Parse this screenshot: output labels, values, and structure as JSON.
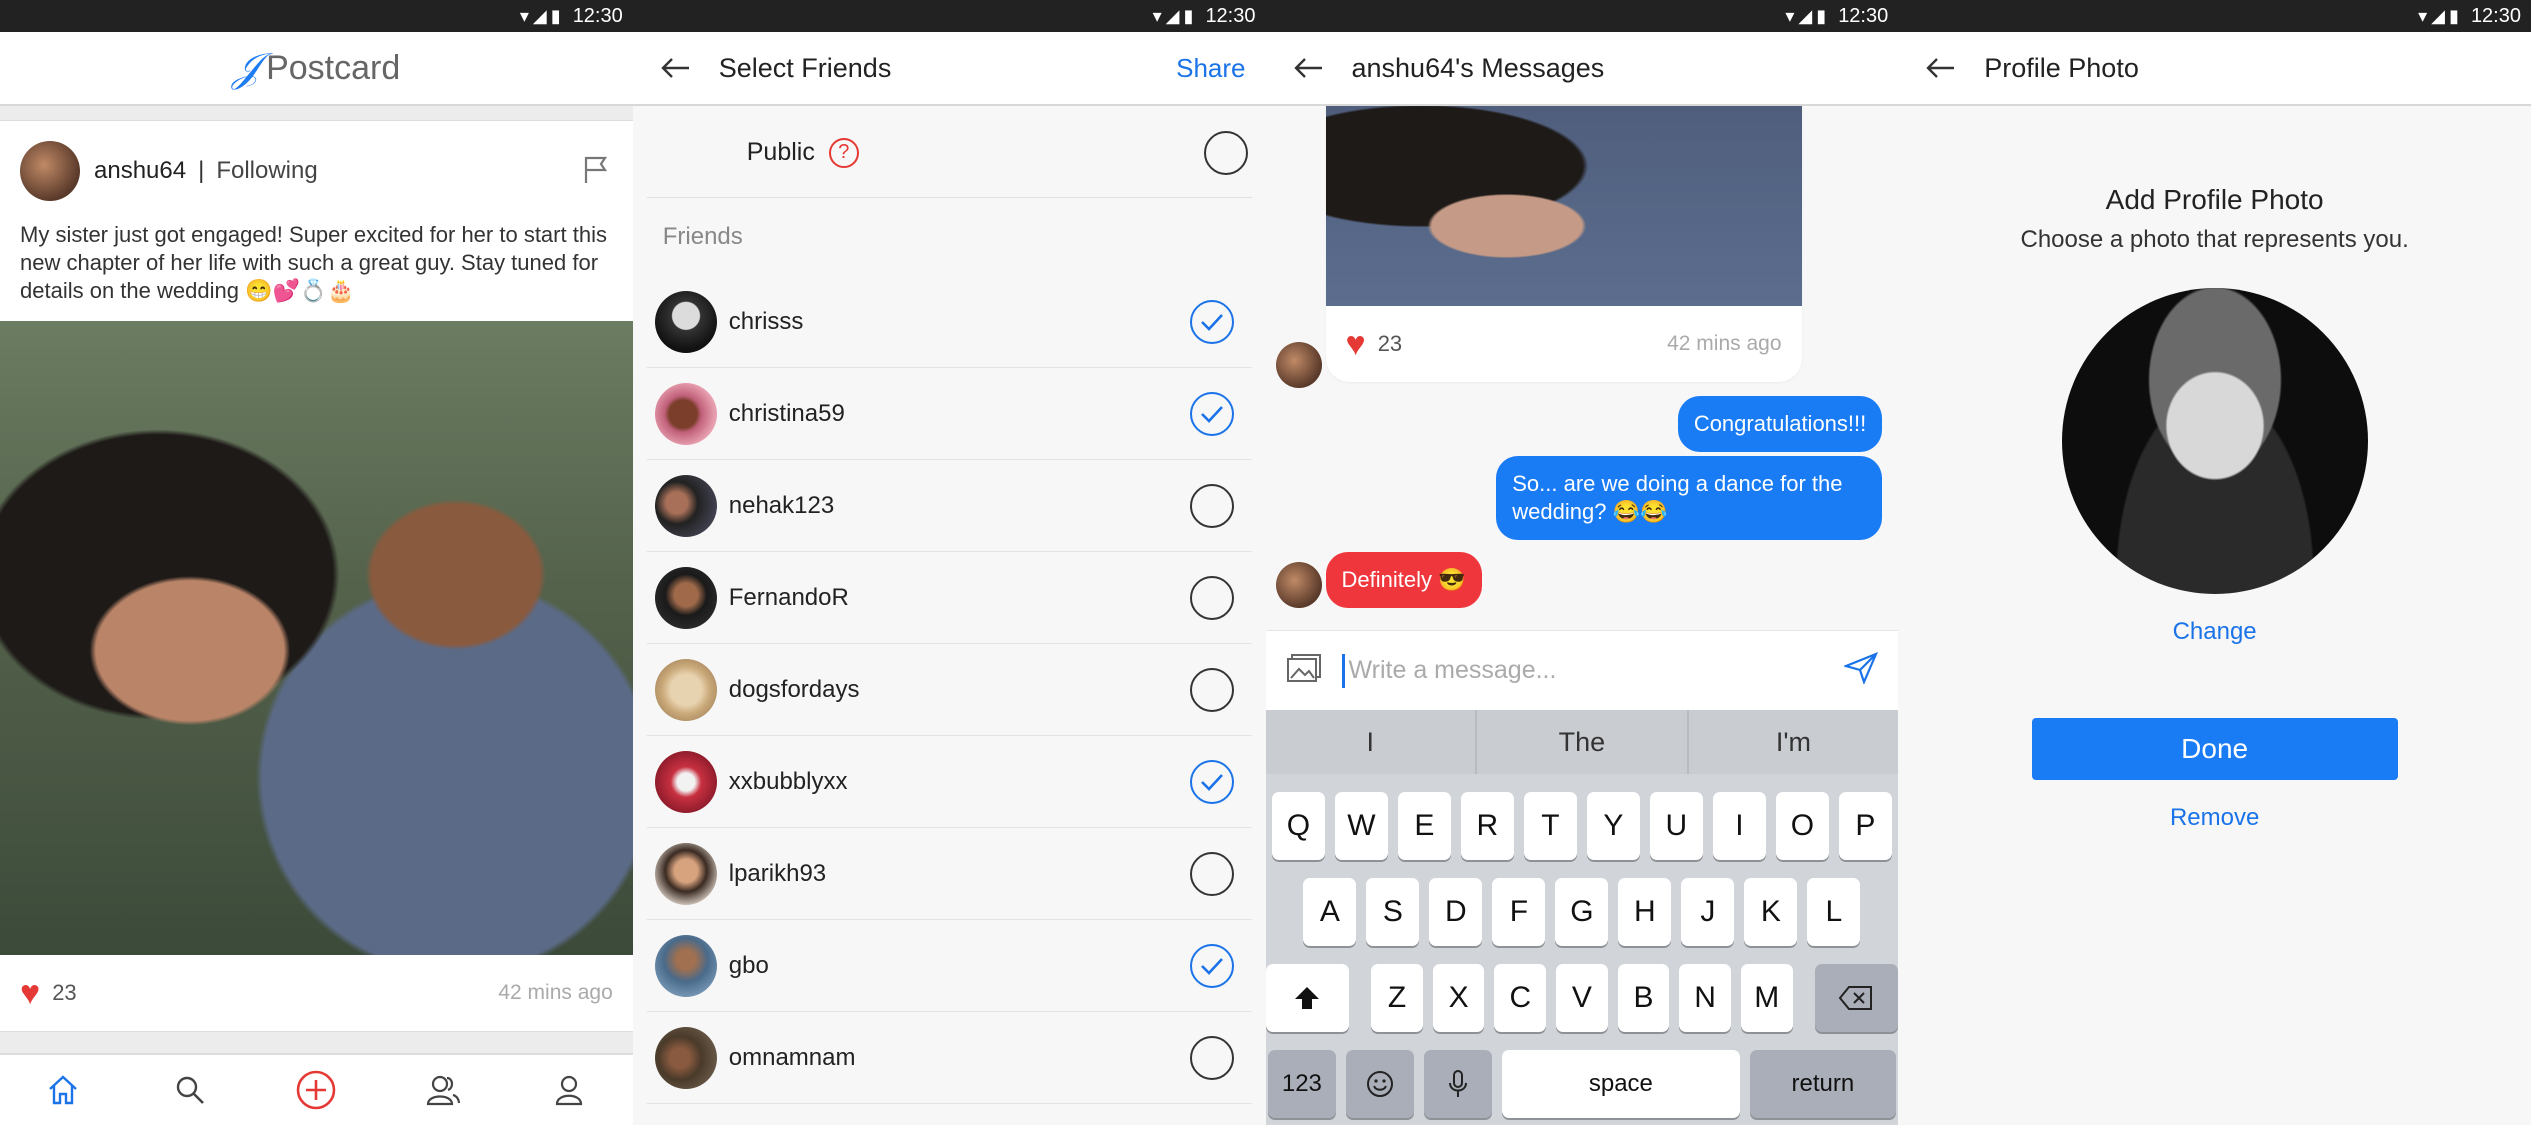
{
  "status": {
    "time": "12:30"
  },
  "feed": {
    "app_name": "Postcard",
    "post": {
      "username": "anshu64",
      "separator": "|",
      "follow_label": "Following",
      "text": "My sister just got engaged! Super excited for her to start this new chapter of her life with such a great guy. Stay tuned for details on the wedding 😁💕💍🎂",
      "likes": "23",
      "time": "42 mins ago"
    },
    "tabs": [
      "home-icon",
      "search-icon",
      "add-icon",
      "friends-icon",
      "profile-icon"
    ]
  },
  "select_friends": {
    "title": "Select Friends",
    "action": "Share",
    "public_label": "Public",
    "help": "?",
    "section_label": "Friends",
    "friends": [
      {
        "name": "chrisss",
        "checked": true
      },
      {
        "name": "christina59",
        "checked": true
      },
      {
        "name": "nehak123",
        "checked": false
      },
      {
        "name": "FernandoR",
        "checked": false
      },
      {
        "name": "dogsfordays",
        "checked": false
      },
      {
        "name": "xxbubblyxx",
        "checked": true
      },
      {
        "name": "lparikh93",
        "checked": false
      },
      {
        "name": "gbo",
        "checked": true
      },
      {
        "name": "omnamnam",
        "checked": false
      }
    ]
  },
  "messages": {
    "title": "anshu64's Messages",
    "photo_likes": "23",
    "photo_time": "42 mins ago",
    "msg1": "Congratulations!!!",
    "msg2": "So... are we doing a dance for the wedding? 😂😂",
    "msg3": "Definitely 😎",
    "placeholder": "Write a message...",
    "suggestions": [
      "I",
      "The",
      "I'm"
    ],
    "keys_row1": [
      "Q",
      "W",
      "E",
      "R",
      "T",
      "Y",
      "U",
      "I",
      "O",
      "P"
    ],
    "keys_row2": [
      "A",
      "S",
      "D",
      "F",
      "G",
      "H",
      "J",
      "K",
      "L"
    ],
    "keys_row3": [
      "Z",
      "X",
      "C",
      "V",
      "B",
      "N",
      "M"
    ],
    "key_123": "123",
    "key_space": "space",
    "key_return": "return"
  },
  "profile": {
    "title": "Profile Photo",
    "heading": "Add Profile Photo",
    "subheading": "Choose a photo that represents you.",
    "change": "Change",
    "done": "Done",
    "remove": "Remove"
  },
  "colors": {
    "accent": "#1a7cf5",
    "heart": "#e53935",
    "alert": "#f0363d"
  }
}
